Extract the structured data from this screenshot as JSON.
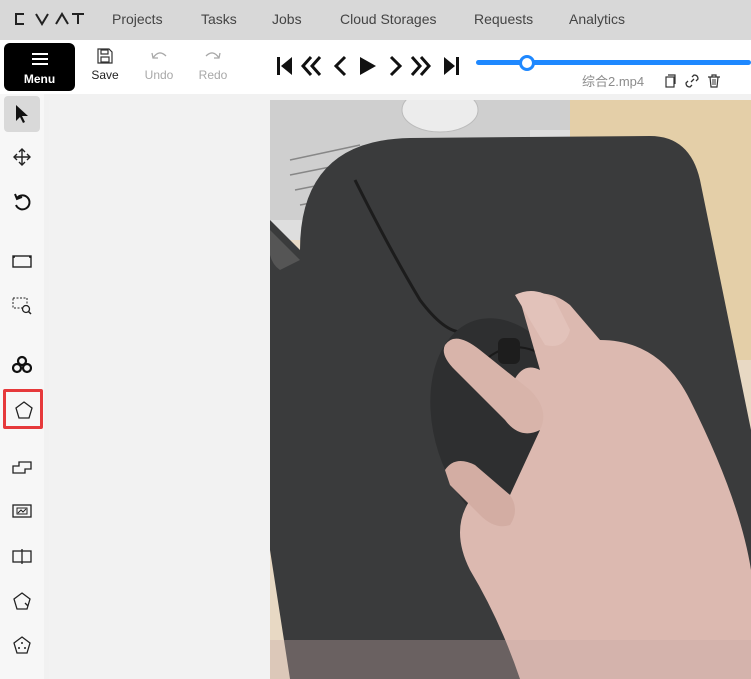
{
  "app": {
    "logo_text": "CVAT",
    "nav": [
      "Projects",
      "Tasks",
      "Jobs",
      "Cloud Storages",
      "Requests",
      "Analytics"
    ]
  },
  "toolbar": {
    "menu_label": "Menu",
    "save_label": "Save",
    "undo_label": "Undo",
    "redo_label": "Redo",
    "player_buttons": [
      "first-frame-icon",
      "back-fast-icon",
      "previous-frame-icon",
      "play-icon",
      "next-frame-icon",
      "forward-fast-icon",
      "last-frame-icon"
    ],
    "filename": "综合2.mp4",
    "file_actions": [
      "copy-icon",
      "link-icon",
      "delete-icon"
    ],
    "frame_slider_position": 0.19
  },
  "controls_sidebar": [
    {
      "name": "cursor-icon",
      "active": true
    },
    {
      "name": "move-icon",
      "active": false
    },
    {
      "name": "rotate-icon",
      "active": false
    },
    {
      "name": "fit-image-icon",
      "active": false
    },
    {
      "name": "zoom-region-icon",
      "active": false
    },
    {
      "name": "ai-tools-icon",
      "active": false
    },
    {
      "name": "polygon-icon",
      "active": false,
      "highlighted": true
    },
    {
      "name": "rectangle-icon",
      "active": false
    },
    {
      "name": "tag-icon",
      "active": false
    },
    {
      "name": "split-icon",
      "active": false
    },
    {
      "name": "group-icon",
      "active": false
    },
    {
      "name": "merge-icon",
      "active": false
    }
  ],
  "colors": {
    "nav_bg": "#d8d8d8",
    "accent": "#1e88ff",
    "highlight": "#e6393b"
  },
  "canvas": {
    "content": "video frame: hand holding a black computer mouse on a dark mouse pad"
  }
}
